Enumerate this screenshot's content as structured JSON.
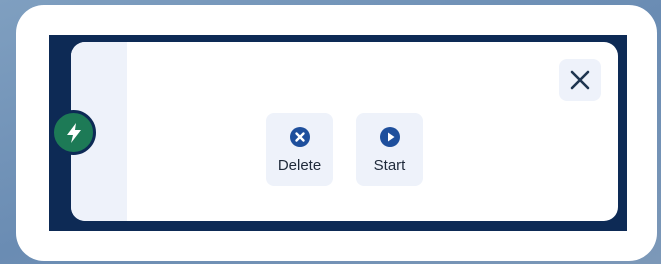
{
  "actions": {
    "delete_label": "Delete",
    "start_label": "Start"
  },
  "icons": {
    "badge": "lightning-bolt-icon",
    "close": "close-icon",
    "delete": "circle-x-icon",
    "start": "circle-play-icon"
  },
  "colors": {
    "frame": "#0d2a55",
    "badge": "#1d7a56",
    "button_bg": "#eef2fa",
    "icon_blue": "#1e4f9c"
  }
}
